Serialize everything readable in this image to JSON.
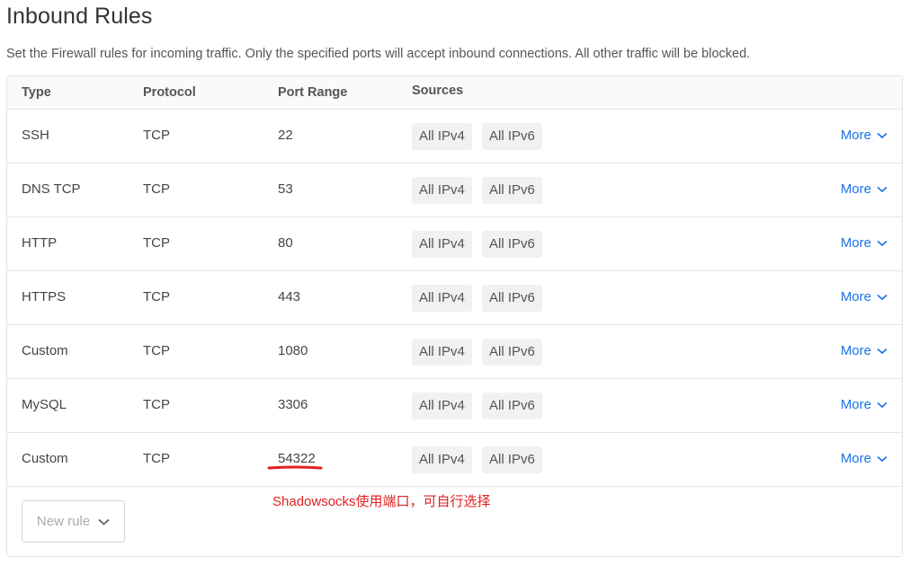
{
  "page": {
    "title": "Inbound Rules",
    "description": "Set the Firewall rules for incoming traffic. Only the specified ports will accept inbound connections. All other traffic will be blocked."
  },
  "table": {
    "headers": {
      "type": "Type",
      "protocol": "Protocol",
      "port_range": "Port Range",
      "sources": "Sources"
    },
    "rows": [
      {
        "type": "SSH",
        "protocol": "TCP",
        "port": "22",
        "source1": "All IPv4",
        "source2": "All IPv6",
        "more": "More"
      },
      {
        "type": "DNS TCP",
        "protocol": "TCP",
        "port": "53",
        "source1": "All IPv4",
        "source2": "All IPv6",
        "more": "More"
      },
      {
        "type": "HTTP",
        "protocol": "TCP",
        "port": "80",
        "source1": "All IPv4",
        "source2": "All IPv6",
        "more": "More"
      },
      {
        "type": "HTTPS",
        "protocol": "TCP",
        "port": "443",
        "source1": "All IPv4",
        "source2": "All IPv6",
        "more": "More"
      },
      {
        "type": "Custom",
        "protocol": "TCP",
        "port": "1080",
        "source1": "All IPv4",
        "source2": "All IPv6",
        "more": "More"
      },
      {
        "type": "MySQL",
        "protocol": "TCP",
        "port": "3306",
        "source1": "All IPv4",
        "source2": "All IPv6",
        "more": "More"
      },
      {
        "type": "Custom",
        "protocol": "TCP",
        "port": "54322",
        "source1": "All IPv4",
        "source2": "All IPv6",
        "more": "More"
      }
    ]
  },
  "new_rule": {
    "label": "New rule"
  },
  "annotation": {
    "text": "Shadowsocks使用端口，可自行选择",
    "color": "#e02020"
  },
  "colors": {
    "link": "#1a73e8",
    "badge_bg": "#f1f1f1"
  }
}
